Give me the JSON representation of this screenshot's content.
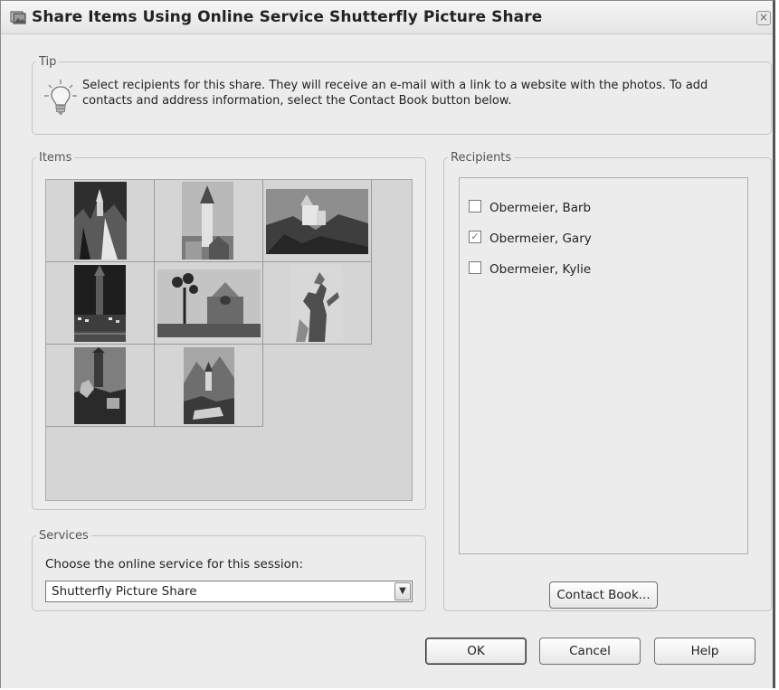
{
  "window": {
    "title": "Share Items Using Online Service Shutterfly Picture Share",
    "close_glyph": "×"
  },
  "tip": {
    "legend": "Tip",
    "text": "Select recipients for this share. They will receive an e-mail with a link to a website with the photos. To add contacts and address information, select the Contact Book button below.",
    "icon": "lightbulb-icon"
  },
  "items": {
    "legend": "Items",
    "photos": [
      {
        "subject": "castle on cliff"
      },
      {
        "subject": "church tower"
      },
      {
        "subject": "castle on hill"
      },
      {
        "subject": "church at night"
      },
      {
        "subject": "street lamps and building"
      },
      {
        "subject": "statue"
      },
      {
        "subject": "palace and statue"
      },
      {
        "subject": "church in mountains"
      }
    ]
  },
  "recipients": {
    "legend": "Recipients",
    "list": [
      {
        "name": "Obermeier, Barb",
        "checked": false
      },
      {
        "name": "Obermeier, Gary",
        "checked": true
      },
      {
        "name": "Obermeier, Kylie",
        "checked": false
      }
    ],
    "contact_book_label": "Contact Book..."
  },
  "services": {
    "legend": "Services",
    "label": "Choose the online service for this session:",
    "selected": "Shutterfly Picture Share"
  },
  "buttons": {
    "ok": "OK",
    "cancel": "Cancel",
    "help": "Help"
  },
  "colors": {
    "dialog_bg": "#ececec",
    "grid_bg": "#d5d5d5",
    "cell_bg": "#d0d0d0"
  }
}
